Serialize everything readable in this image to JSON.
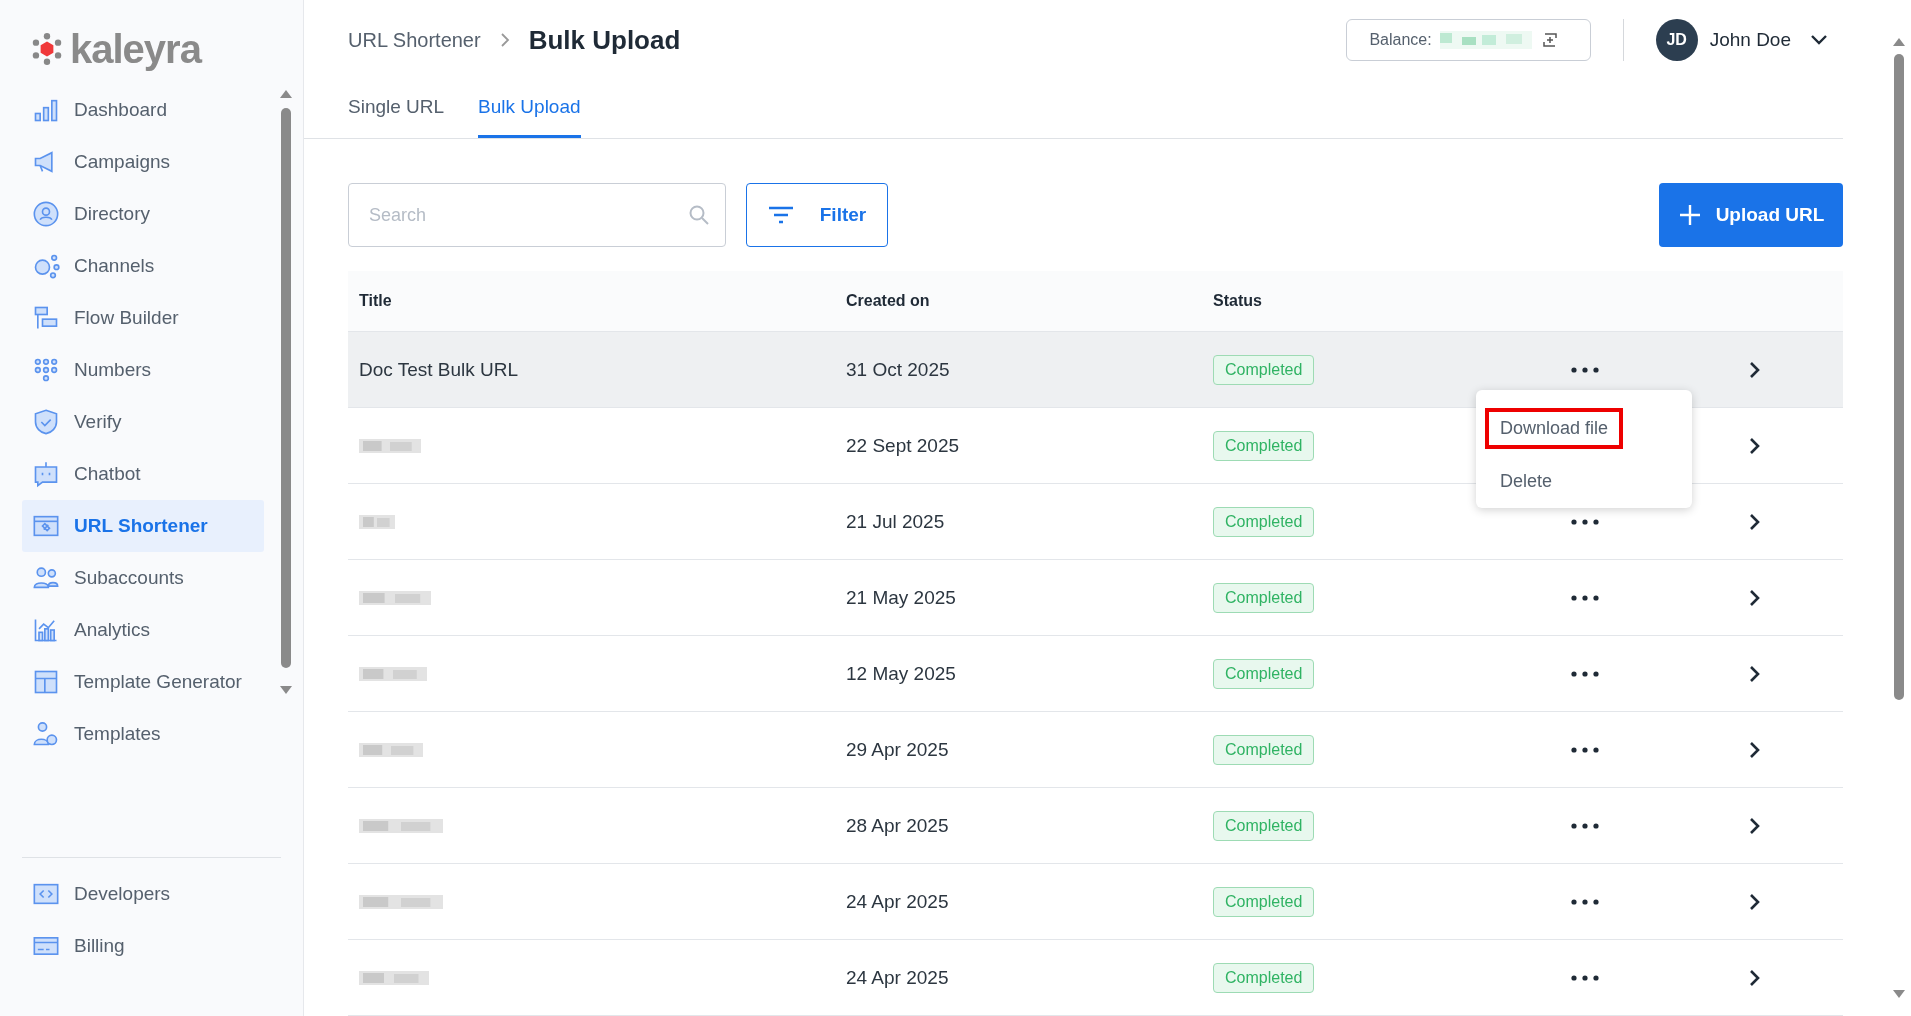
{
  "logo": {
    "text": "kaleyra"
  },
  "sidebar": {
    "items": [
      {
        "label": "Dashboard",
        "selected": false
      },
      {
        "label": "Campaigns",
        "selected": false
      },
      {
        "label": "Directory",
        "selected": false
      },
      {
        "label": "Channels",
        "selected": false
      },
      {
        "label": "Flow Builder",
        "selected": false
      },
      {
        "label": "Numbers",
        "selected": false
      },
      {
        "label": "Verify",
        "selected": false
      },
      {
        "label": "Chatbot",
        "selected": false
      },
      {
        "label": "URL Shortener",
        "selected": true
      },
      {
        "label": "Subaccounts",
        "selected": false
      },
      {
        "label": "Analytics",
        "selected": false
      },
      {
        "label": "Template Generator",
        "selected": false
      },
      {
        "label": "Templates",
        "selected": false
      }
    ],
    "footer_items": [
      {
        "label": "Developers",
        "selected": false
      },
      {
        "label": "Billing",
        "selected": false
      }
    ]
  },
  "breadcrumb": {
    "parent": "URL Shortener",
    "current": "Bulk Upload"
  },
  "balance": {
    "label": "Balance:",
    "value_blurred": true
  },
  "user": {
    "initials": "JD",
    "name": "John Doe"
  },
  "tabs": [
    {
      "label": "Single URL",
      "selected": false
    },
    {
      "label": "Bulk Upload",
      "selected": true
    }
  ],
  "search": {
    "placeholder": "Search"
  },
  "filter_button": "Filter",
  "upload_button": "Upload URL",
  "table": {
    "columns": [
      "Title",
      "Created on",
      "Status"
    ],
    "rows": [
      {
        "title": "Doc Test Bulk URL",
        "title_blurred": false,
        "created_on": "31 Oct 2025",
        "status": "Completed",
        "hovered": true
      },
      {
        "title_blurred": true,
        "created_on": "22 Sept 2025",
        "status": "Completed",
        "hovered": false
      },
      {
        "title_blurred": true,
        "created_on": "21 Jul 2025",
        "status": "Completed",
        "hovered": false
      },
      {
        "title_blurred": true,
        "created_on": "21 May 2025",
        "status": "Completed",
        "hovered": false
      },
      {
        "title_blurred": true,
        "created_on": "12 May 2025",
        "status": "Completed",
        "hovered": false
      },
      {
        "title_blurred": true,
        "created_on": "29 Apr 2025",
        "status": "Completed",
        "hovered": false
      },
      {
        "title_blurred": true,
        "created_on": "28 Apr 2025",
        "status": "Completed",
        "hovered": false
      },
      {
        "title_blurred": true,
        "created_on": "24 Apr 2025",
        "status": "Completed",
        "hovered": false
      },
      {
        "title_blurred": true,
        "created_on": "24 Apr 2025",
        "status": "Completed",
        "hovered": false
      }
    ]
  },
  "row_menu": {
    "items": [
      {
        "label": "Download file",
        "highlighted": true
      },
      {
        "label": "Delete",
        "highlighted": false
      }
    ]
  }
}
